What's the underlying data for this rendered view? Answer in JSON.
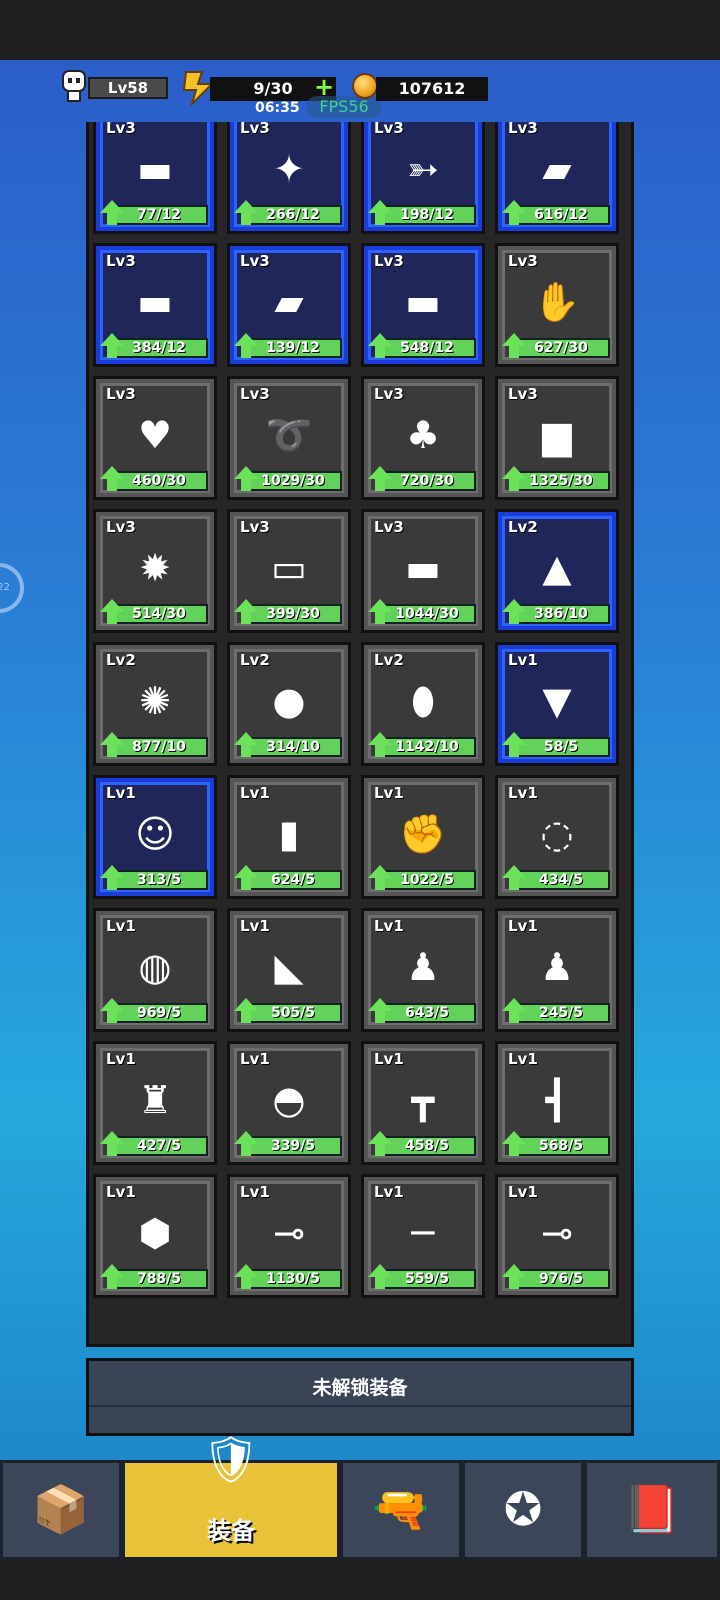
{
  "hud": {
    "level": "Lv58",
    "energy": "9/30",
    "energy_plus": "+",
    "timer": "06:35",
    "fps": "FPS56",
    "coins": "107612"
  },
  "side_button": {
    "label": "22"
  },
  "items": [
    {
      "level": "Lv3",
      "progress": "77/12",
      "icon": "shotgun-icon",
      "glyph": "▬",
      "rarity": "blue"
    },
    {
      "level": "Lv3",
      "progress": "266/12",
      "icon": "shuriken-icon",
      "glyph": "✦",
      "rarity": "blue"
    },
    {
      "level": "Lv3",
      "progress": "198/12",
      "icon": "arrow-icon",
      "glyph": "➳",
      "rarity": "blue"
    },
    {
      "level": "Lv3",
      "progress": "616/12",
      "icon": "laser-pistol-icon",
      "glyph": "▰",
      "rarity": "blue"
    },
    {
      "level": "Lv3",
      "progress": "384/12",
      "icon": "red-shotgun-icon",
      "glyph": "▬",
      "rarity": "blue"
    },
    {
      "level": "Lv3",
      "progress": "139/12",
      "icon": "pistol-icon",
      "glyph": "▰",
      "rarity": "blue"
    },
    {
      "level": "Lv3",
      "progress": "548/12",
      "icon": "rocket-launcher-icon",
      "glyph": "▬",
      "rarity": "blue"
    },
    {
      "level": "Lv3",
      "progress": "627/30",
      "icon": "white-glove-icon",
      "glyph": "✋",
      "rarity": "gray"
    },
    {
      "level": "Lv3",
      "progress": "460/30",
      "icon": "heart-necklace-icon",
      "glyph": "♥",
      "rarity": "gray"
    },
    {
      "level": "Lv3",
      "progress": "1029/30",
      "icon": "fang-necklace-icon",
      "glyph": "➰",
      "rarity": "gray"
    },
    {
      "level": "Lv3",
      "progress": "720/30",
      "icon": "pink-armor-icon",
      "glyph": "♣",
      "rarity": "gray"
    },
    {
      "level": "Lv3",
      "progress": "1325/30",
      "icon": "paper-bag-mask-icon",
      "glyph": "▆",
      "rarity": "gray"
    },
    {
      "level": "Lv3",
      "progress": "514/30",
      "icon": "lion-mask-icon",
      "glyph": "✹",
      "rarity": "gray"
    },
    {
      "level": "Lv3",
      "progress": "399/30",
      "icon": "water-gun-icon",
      "glyph": "▭",
      "rarity": "gray"
    },
    {
      "level": "Lv3",
      "progress": "1044/30",
      "icon": "rifle-icon",
      "glyph": "▬",
      "rarity": "gray"
    },
    {
      "level": "Lv2",
      "progress": "386/10",
      "icon": "straw-hat-icon",
      "glyph": "▲",
      "rarity": "blue"
    },
    {
      "level": "Lv2",
      "progress": "877/10",
      "icon": "spiked-mace-icon",
      "glyph": "✺",
      "rarity": "gray"
    },
    {
      "level": "Lv2",
      "progress": "314/10",
      "icon": "cloth-icon",
      "glyph": "●",
      "rarity": "gray"
    },
    {
      "level": "Lv2",
      "progress": "1142/10",
      "icon": "shield-icon",
      "glyph": "⬮",
      "rarity": "gray"
    },
    {
      "level": "Lv1",
      "progress": "58/5",
      "icon": "boots-icon",
      "glyph": "▼",
      "rarity": "blue"
    },
    {
      "level": "Lv1",
      "progress": "313/5",
      "icon": "fox-mask-icon",
      "glyph": "☺",
      "rarity": "blue"
    },
    {
      "level": "Lv1",
      "progress": "624/5",
      "icon": "gauntlet-icon",
      "glyph": "▮",
      "rarity": "gray"
    },
    {
      "level": "Lv1",
      "progress": "1022/5",
      "icon": "leather-glove-icon",
      "glyph": "✊",
      "rarity": "gray"
    },
    {
      "level": "Lv1",
      "progress": "434/5",
      "icon": "bead-necklace-icon",
      "glyph": "◌",
      "rarity": "gray"
    },
    {
      "level": "Lv1",
      "progress": "969/5",
      "icon": "ruby-necklace-icon",
      "glyph": "◍",
      "rarity": "gray"
    },
    {
      "level": "Lv1",
      "progress": "505/5",
      "icon": "sandals-icon",
      "glyph": "◣",
      "rarity": "gray"
    },
    {
      "level": "Lv1",
      "progress": "643/5",
      "icon": "blue-jacket-icon",
      "glyph": "♟",
      "rarity": "gray"
    },
    {
      "level": "Lv1",
      "progress": "245/5",
      "icon": "white-jacket-icon",
      "glyph": "♟",
      "rarity": "gray"
    },
    {
      "level": "Lv1",
      "progress": "427/5",
      "icon": "skeleton-armor-icon",
      "glyph": "♜",
      "rarity": "gray"
    },
    {
      "level": "Lv1",
      "progress": "339/5",
      "icon": "helmet-icon",
      "glyph": "◓",
      "rarity": "gray"
    },
    {
      "level": "Lv1",
      "progress": "458/5",
      "icon": "hammer-icon",
      "glyph": "┳",
      "rarity": "gray"
    },
    {
      "level": "Lv1",
      "progress": "568/5",
      "icon": "axe-icon",
      "glyph": "┫",
      "rarity": "gray"
    },
    {
      "level": "Lv1",
      "progress": "788/5",
      "icon": "stone-icon",
      "glyph": "⬢",
      "rarity": "gray"
    },
    {
      "level": "Lv1",
      "progress": "1130/5",
      "icon": "syringe-icon",
      "glyph": "⊸",
      "rarity": "gray"
    },
    {
      "level": "Lv1",
      "progress": "559/5",
      "icon": "katana-icon",
      "glyph": "─",
      "rarity": "gray"
    },
    {
      "level": "Lv1",
      "progress": "976/5",
      "icon": "shovel-icon",
      "glyph": "⊸",
      "rarity": "gray"
    }
  ],
  "unlock_section": {
    "label": "未解锁装备"
  },
  "nav": {
    "tabs": [
      {
        "id": "box",
        "icon": "box-icon",
        "glyph": "📦",
        "label": ""
      },
      {
        "id": "equipment",
        "icon": "armor-icon",
        "glyph": "🛡",
        "label": "装备"
      },
      {
        "id": "bullet",
        "icon": "bullet-icon",
        "glyph": "🔫",
        "label": ""
      },
      {
        "id": "star",
        "icon": "star-emblem-icon",
        "glyph": "✪",
        "label": ""
      },
      {
        "id": "book",
        "icon": "book-icon",
        "glyph": "📕",
        "label": ""
      }
    ]
  },
  "colors": {
    "bg_top": "#2b5ec9",
    "bg_bottom": "#26a8dc",
    "progress_green": "#63d25a",
    "rarity_blue": "#2c62ff",
    "active_tab": "#e8c238"
  }
}
